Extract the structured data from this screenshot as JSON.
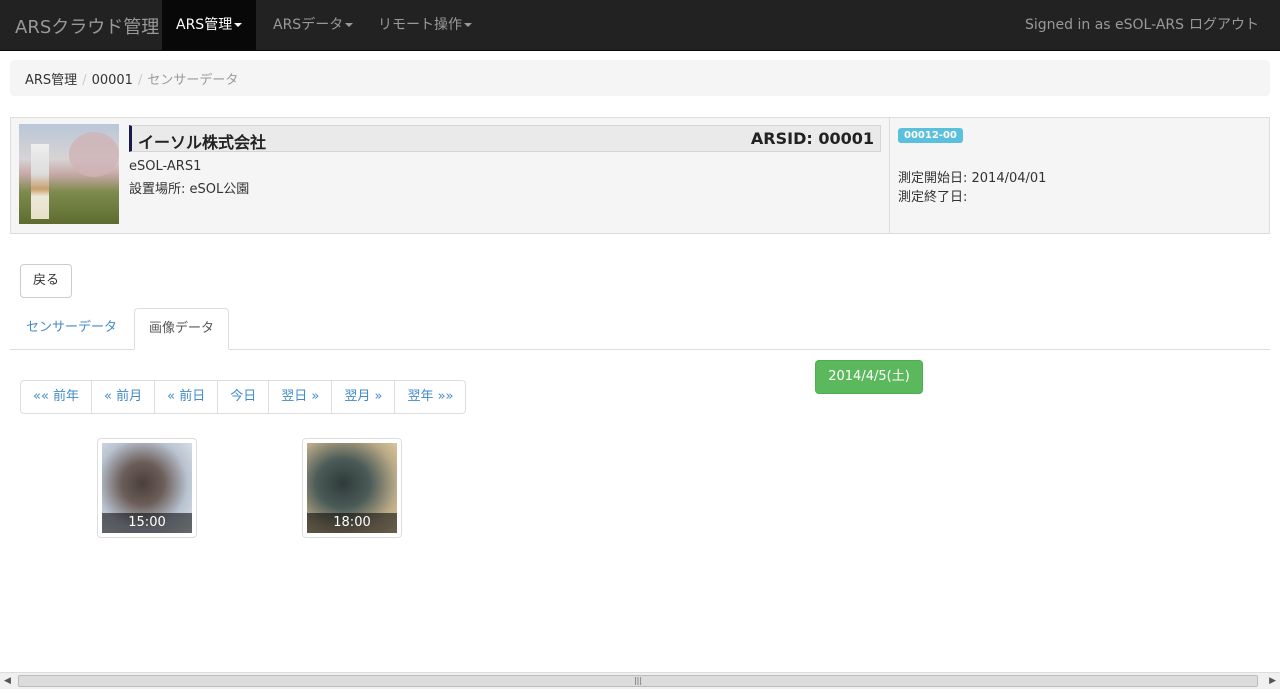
{
  "navbar": {
    "brand": "ARSクラウド管理",
    "items": [
      {
        "label": "ARS管理"
      },
      {
        "label": "ARSデータ"
      },
      {
        "label": "リモート操作"
      }
    ],
    "signed_in": "Signed in as eSOL-ARS",
    "logout": "ログアウト"
  },
  "breadcrumb": {
    "items": [
      "ARS管理",
      "00001",
      "センサーデータ"
    ],
    "separator": "/"
  },
  "device": {
    "company": "イーソル株式会社",
    "arsid": "ARSID: 00001",
    "model": "eSOL-ARS1",
    "location": "設置場所: eSOL公園",
    "badge": "00012-00",
    "start_date": "測定開始日: 2014/04/01",
    "end_date": "測定終了日:"
  },
  "back_button": "戻る",
  "tabs": [
    {
      "label": "センサーデータ"
    },
    {
      "label": "画像データ"
    }
  ],
  "current_date": "2014/4/5(土)",
  "pager": [
    "«« 前年",
    "« 前月",
    "« 前日",
    "今日",
    "翌日 »",
    "翌月 »",
    "翌年 »»"
  ],
  "thumbnails": [
    {
      "time": "15:00"
    },
    {
      "time": "18:00"
    }
  ],
  "colors": {
    "navbar_bg": "#222222",
    "link": "#428bca",
    "success": "#5cb85c",
    "info": "#5bc0de"
  }
}
